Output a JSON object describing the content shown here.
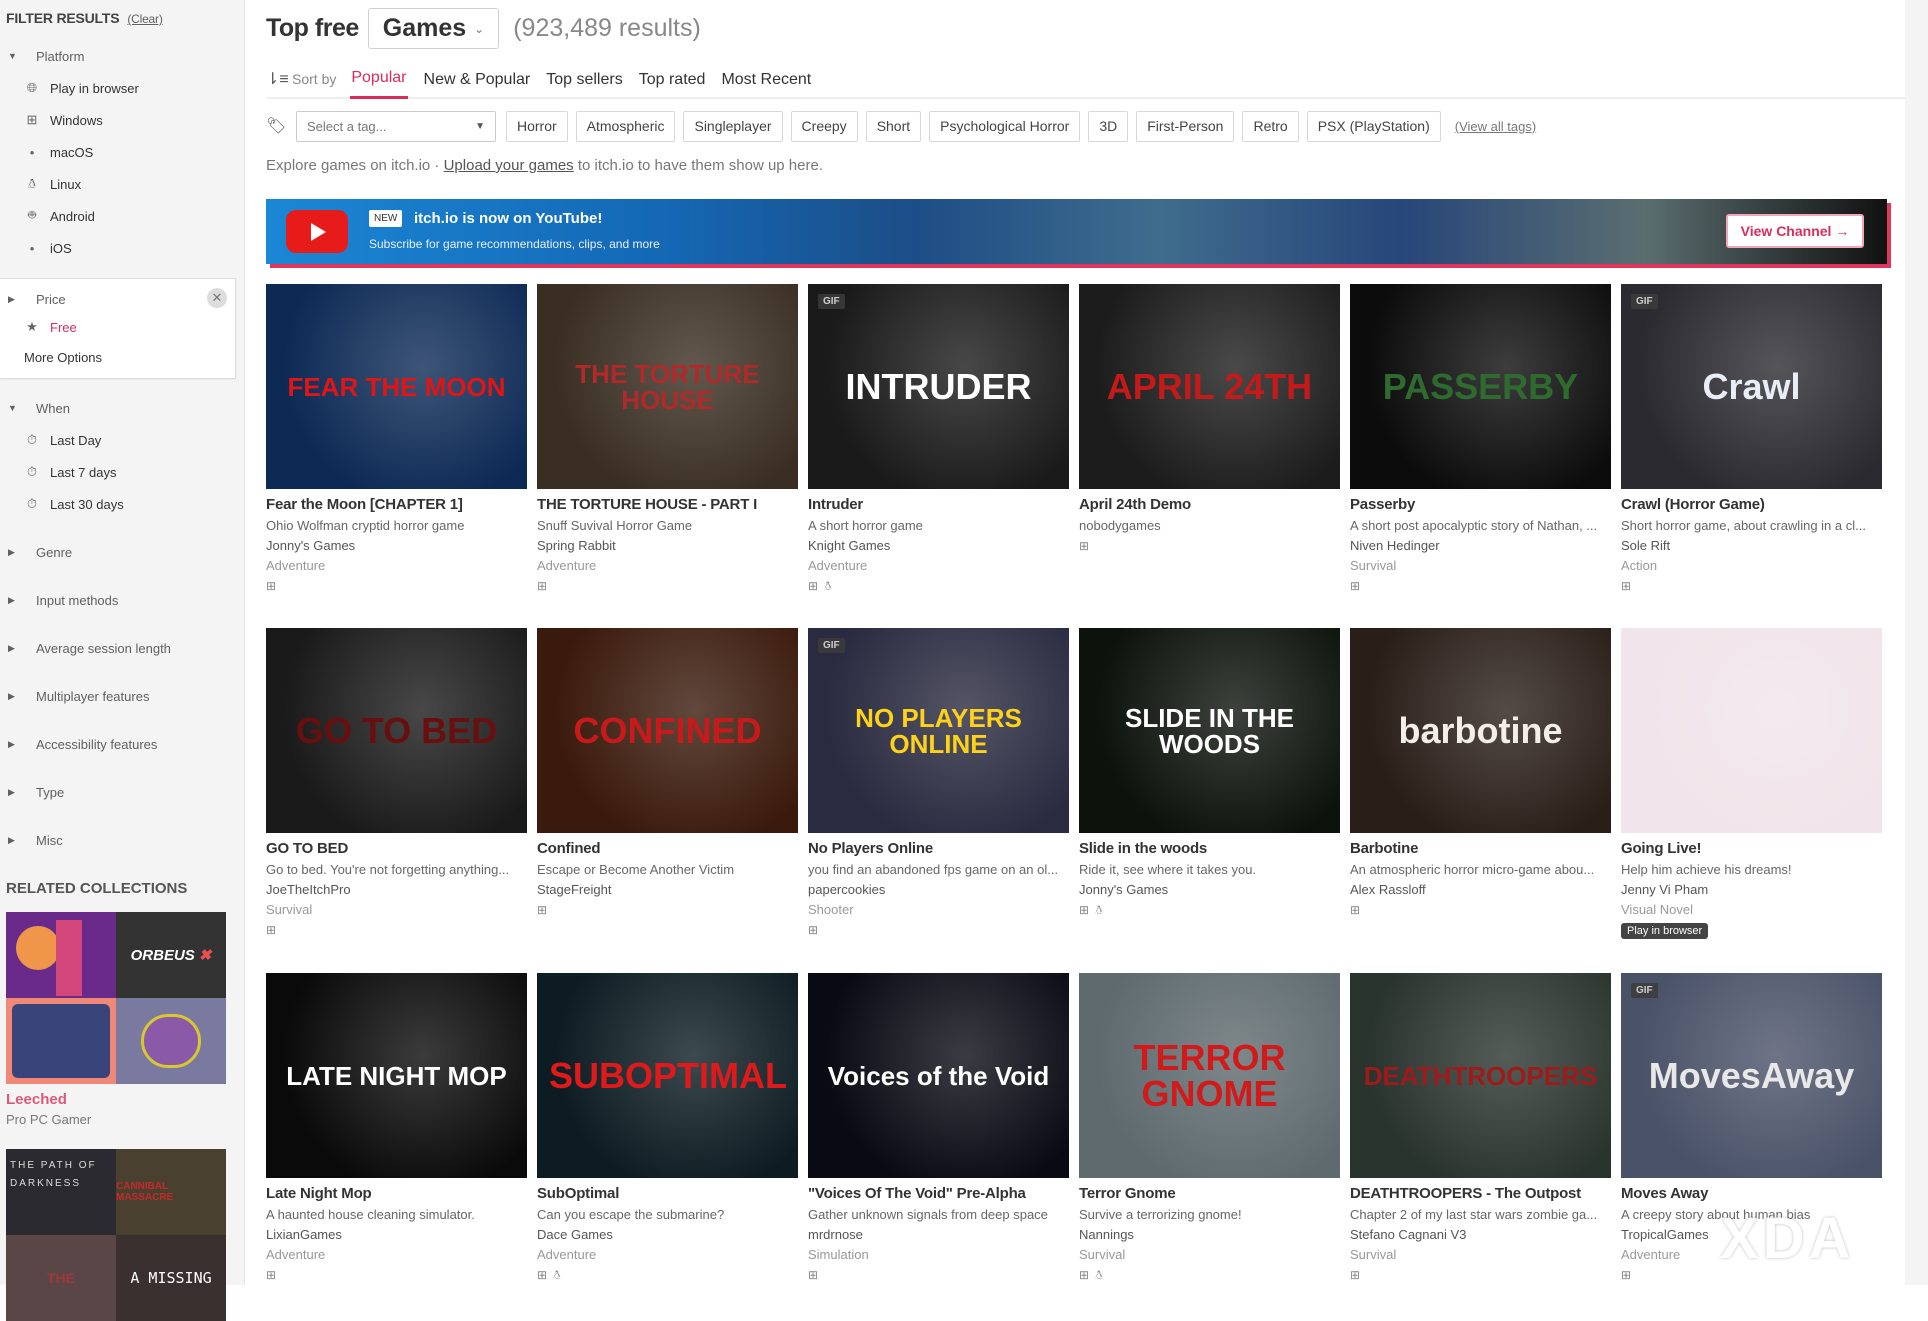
{
  "sidebar": {
    "heading": "FILTER RESULTS",
    "clear": "(Clear)",
    "platform": {
      "title": "Platform",
      "items": [
        {
          "label": "Play in browser",
          "icon": "globe"
        },
        {
          "label": "Windows",
          "icon": "windows"
        },
        {
          "label": "macOS",
          "icon": "apple"
        },
        {
          "label": "Linux",
          "icon": "tux"
        },
        {
          "label": "Android",
          "icon": "android"
        },
        {
          "label": "iOS",
          "icon": "apple"
        }
      ]
    },
    "price": {
      "title": "Price",
      "selected": "Free",
      "more": "More Options"
    },
    "when": {
      "title": "When",
      "items": [
        {
          "label": "Last Day"
        },
        {
          "label": "Last 7 days"
        },
        {
          "label": "Last 30 days"
        }
      ]
    },
    "collapsed": [
      "Genre",
      "Input methods",
      "Average session length",
      "Multiplayer features",
      "Accessibility features",
      "Type",
      "Misc"
    ],
    "related_title": "RELATED COLLECTIONS",
    "collections": [
      {
        "name": "Leeched",
        "by": "Pro PC Gamer",
        "tiles": [
          "",
          "ORBEUS",
          "",
          ""
        ]
      },
      {
        "name": "",
        "by": "",
        "tiles": [
          "THE PATH OF DARKNESS",
          "CANNIBAL MASSACRE",
          "THE",
          "A MISSING"
        ]
      }
    ]
  },
  "header": {
    "title": "Top free",
    "category": "Games",
    "results": "(923,489 results)"
  },
  "sort": {
    "label": "Sort by",
    "tabs": [
      "Popular",
      "New & Popular",
      "Top sellers",
      "Top rated",
      "Most Recent"
    ],
    "active": "Popular"
  },
  "tags": {
    "placeholder": "Select a tag...",
    "items": [
      "Horror",
      "Atmospheric",
      "Singleplayer",
      "Creepy",
      "Short",
      "Psychological Horror",
      "3D",
      "First-Person",
      "Retro",
      "PSX (PlayStation)"
    ],
    "view_all": "(View all tags)"
  },
  "explore": {
    "pre": "Explore games on itch.io · ",
    "link": "Upload your games",
    "post": " to itch.io to have them show up here."
  },
  "banner": {
    "badge": "NEW",
    "title": "itch.io is now on YouTube!",
    "subtitle": "Subscribe for game recommendations, clips, and more",
    "button": "View Channel →"
  },
  "games": [
    {
      "title": "Fear the Moon [CHAPTER 1]",
      "desc": "Ohio Wolfman cryptid horror game",
      "author": "Jonny's Games",
      "genre": "Adventure",
      "platforms": [
        "windows"
      ],
      "gif": false,
      "art": "FEAR THE MOON",
      "bg": "#0d2a55",
      "fg": "#e01515"
    },
    {
      "title": "THE TORTURE HOUSE - PART I",
      "desc": "Snuff Suvival Horror Game",
      "author": "Spring Rabbit",
      "genre": "Adventure",
      "platforms": [
        "windows"
      ],
      "gif": false,
      "art": "THE TORTURE HOUSE",
      "bg": "#3a2e22",
      "fg": "#b02a2a"
    },
    {
      "title": "Intruder",
      "desc": "A short horror game",
      "author": "Knight Games",
      "genre": "Adventure",
      "platforms": [
        "windows",
        "linux",
        "apple"
      ],
      "gif": true,
      "art": "INTRUDER",
      "bg": "#1a1a1a",
      "fg": "#ffffff"
    },
    {
      "title": "April 24th Demo",
      "desc": "nobodygames",
      "author": "",
      "genre": "",
      "platforms": [
        "windows"
      ],
      "gif": false,
      "art": "APRIL 24TH",
      "bg": "#1c1c1c",
      "fg": "#c41a1a"
    },
    {
      "title": "Passerby",
      "desc": "A short post apocalyptic story of Nathan, ...",
      "author": "Niven Hedinger",
      "genre": "Survival",
      "platforms": [
        "windows"
      ],
      "gif": false,
      "art": "PASSERBY",
      "bg": "#0c0c0c",
      "fg": "#2f6b2f"
    },
    {
      "title": "Crawl (Horror Game)",
      "desc": "Short horror game, about crawling in a cl...",
      "author": "Sole Rift",
      "genre": "Action",
      "platforms": [
        "windows"
      ],
      "gif": true,
      "art": "Crawl",
      "bg": "#2a2a30",
      "fg": "#e8eef8"
    },
    {
      "title": "GO TO BED",
      "desc": "Go to bed. You're not forgetting anything...",
      "author": "JoeTheItchPro",
      "genre": "Survival",
      "platforms": [
        "windows",
        "apple"
      ],
      "gif": false,
      "art": "GO TO BED",
      "bg": "#1a1a1a",
      "fg": "#6a0f0f"
    },
    {
      "title": "Confined",
      "desc": "Escape or Become Another Victim",
      "author": "StageFreight",
      "genre": "",
      "platforms": [
        "windows"
      ],
      "gif": false,
      "art": "CONFINED",
      "bg": "#3a1a0c",
      "fg": "#c81a1a"
    },
    {
      "title": "No Players Online",
      "desc": "you find an abandoned fps game on an ol...",
      "author": "papercookies",
      "genre": "Shooter",
      "platforms": [
        "windows"
      ],
      "gif": true,
      "art": "NO PLAYERS ONLINE",
      "bg": "#2a2a40",
      "fg": "#ffd21a"
    },
    {
      "title": "Slide in the woods",
      "desc": "Ride it, see where it takes you.",
      "author": "Jonny's Games",
      "genre": "",
      "platforms": [
        "windows",
        "linux",
        "apple"
      ],
      "gif": false,
      "art": "SLIDE IN THE WOODS",
      "bg": "#0c120c",
      "fg": "#ffffff"
    },
    {
      "title": "Barbotine",
      "desc": "An atmospheric horror micro-game abou...",
      "author": "Alex Rassloff",
      "genre": "",
      "platforms": [
        "windows"
      ],
      "gif": false,
      "art": "barbotine",
      "bg": "#2a1e18",
      "fg": "#f4eee8"
    },
    {
      "title": "Going Live!",
      "desc": "Help him achieve his dreams!",
      "author": "Jenny Vi Pham",
      "genre": "Visual Novel",
      "platforms": [],
      "gif": false,
      "play_in_browser": "Play in browser",
      "art": "",
      "bg": "#f1e4ea",
      "fg": "#333"
    },
    {
      "title": "Late Night Mop",
      "desc": "A haunted house cleaning simulator.",
      "author": "LixianGames",
      "genre": "Adventure",
      "platforms": [
        "windows",
        "apple"
      ],
      "gif": false,
      "art": "LATE NIGHT MOP",
      "bg": "#0a0a0a",
      "fg": "#ffffff"
    },
    {
      "title": "SubOptimal",
      "desc": "Can you escape the submarine?",
      "author": "Dace Games",
      "genre": "Adventure",
      "platforms": [
        "windows",
        "linux",
        "apple"
      ],
      "gif": false,
      "art": "SUBOPTIMAL",
      "bg": "#0c1c22",
      "fg": "#e01a1a"
    },
    {
      "title": "\"Voices Of The Void\" Pre-Alpha",
      "desc": "Gather unknown signals from deep space",
      "author": "mrdrnose",
      "genre": "Simulation",
      "platforms": [
        "windows"
      ],
      "gif": false,
      "art": "Voices of the Void",
      "bg": "#0a0a14",
      "fg": "#ffffff"
    },
    {
      "title": "Terror Gnome",
      "desc": "Survive a terrorizing gnome!",
      "author": "Nannings",
      "genre": "Survival",
      "platforms": [
        "windows",
        "linux"
      ],
      "gif": false,
      "art": "TERROR GNOME",
      "bg": "#5e6a6e",
      "fg": "#d21a1a"
    },
    {
      "title": "DEATHTROOPERS - The Outpost",
      "desc": "Chapter 2 of my last star wars zombie ga...",
      "author": "Stefano Cagnani V3",
      "genre": "Survival",
      "platforms": [
        "windows"
      ],
      "gif": false,
      "art": "DEATHTROOPERS",
      "bg": "#2a342e",
      "fg": "#a01a1a"
    },
    {
      "title": "Moves Away",
      "desc": "A creepy story about human bias",
      "author": "TropicalGames",
      "genre": "Adventure",
      "platforms": [
        "windows"
      ],
      "gif": true,
      "art": "MovesAway",
      "bg": "#4a5268",
      "fg": "#e8e8e8"
    }
  ],
  "gif_label": "GIF",
  "watermark": "XDA"
}
